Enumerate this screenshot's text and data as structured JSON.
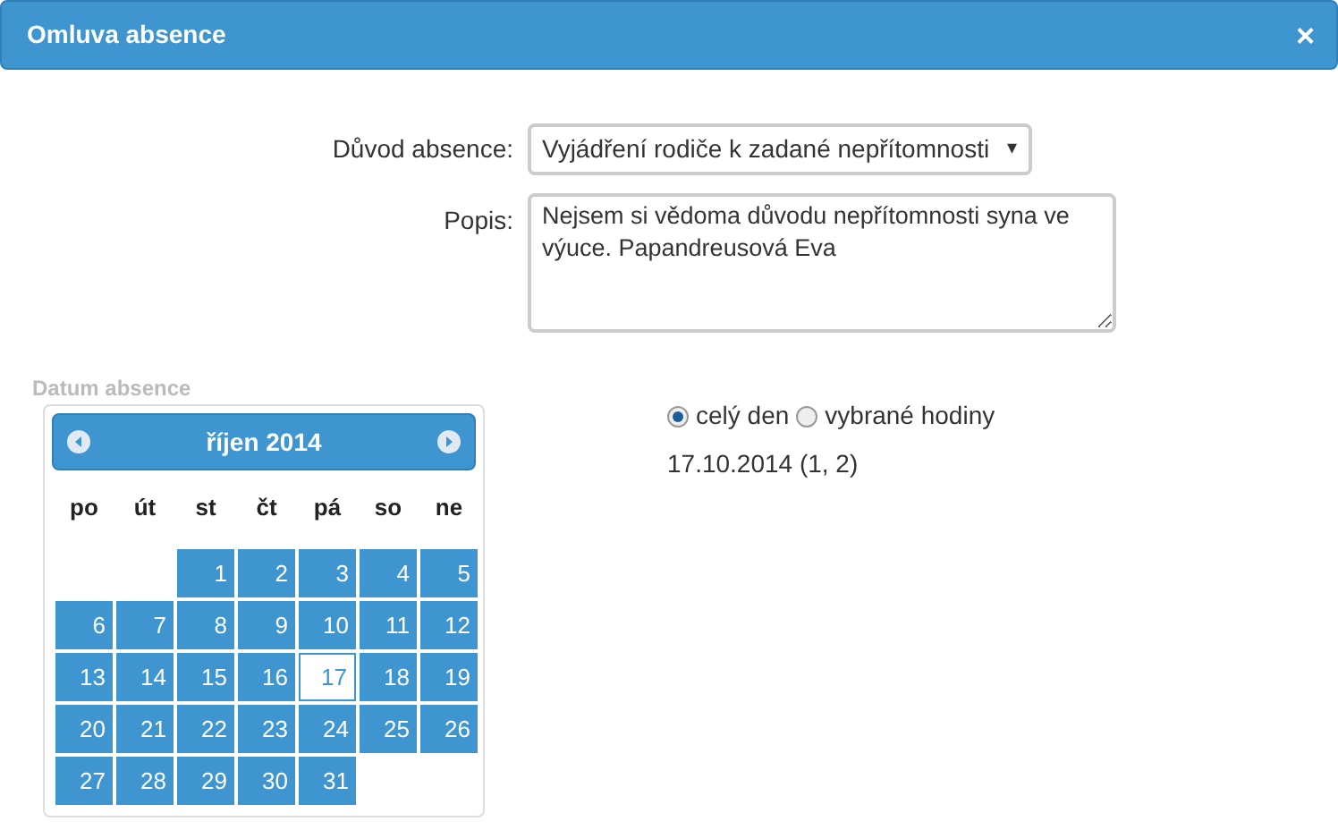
{
  "dialog": {
    "title": "Omluva absence",
    "close": "×"
  },
  "form": {
    "reason_label": "Důvod absence:",
    "reason_value": "Vyjádření rodiče k zadané nepřítomnosti",
    "caret": "▾",
    "description_label": "Popis:",
    "description_value": "Nejsem si vědoma důvodu nepřítomnosti syna ve výuce. Papandreusová Eva"
  },
  "calendar": {
    "section_label": "Datum absence",
    "month": "říjen 2014",
    "weekdays": [
      "po",
      "út",
      "st",
      "čt",
      "pá",
      "so",
      "ne"
    ],
    "weeks": [
      {
        "days": [
          {
            "day": "1",
            "selected": false
          },
          {
            "day": "2",
            "selected": false
          },
          {
            "day": "3",
            "selected": false
          },
          {
            "day": "4",
            "selected": false
          },
          {
            "day": "5",
            "selected": false
          }
        ]
      },
      {
        "days": [
          {
            "day": "6",
            "selected": false
          },
          {
            "day": "7",
            "selected": false
          },
          {
            "day": "8",
            "selected": false
          },
          {
            "day": "9",
            "selected": false
          },
          {
            "day": "10",
            "selected": false
          },
          {
            "day": "11",
            "selected": false
          },
          {
            "day": "12",
            "selected": false
          }
        ]
      },
      {
        "days": [
          {
            "day": "13",
            "selected": false
          },
          {
            "day": "14",
            "selected": false
          },
          {
            "day": "15",
            "selected": false
          },
          {
            "day": "16",
            "selected": false
          },
          {
            "day": "17",
            "selected": true
          },
          {
            "day": "18",
            "selected": false
          },
          {
            "day": "19",
            "selected": false
          }
        ]
      },
      {
        "days": [
          {
            "day": "20",
            "selected": false
          },
          {
            "day": "21",
            "selected": false
          },
          {
            "day": "22",
            "selected": false
          },
          {
            "day": "23",
            "selected": false
          },
          {
            "day": "24",
            "selected": false
          },
          {
            "day": "25",
            "selected": false
          },
          {
            "day": "26",
            "selected": false
          }
        ]
      },
      {
        "days": [
          {
            "day": "27",
            "selected": false
          },
          {
            "day": "28",
            "selected": false
          },
          {
            "day": "29",
            "selected": false
          },
          {
            "day": "30",
            "selected": false
          },
          {
            "day": "31",
            "selected": false
          }
        ]
      }
    ]
  },
  "range": {
    "options": [
      {
        "label": "celý den",
        "selected": true
      },
      {
        "label": "vybrané hodiny",
        "selected": false
      }
    ],
    "summary": "17.10.2014 (1, 2)"
  }
}
